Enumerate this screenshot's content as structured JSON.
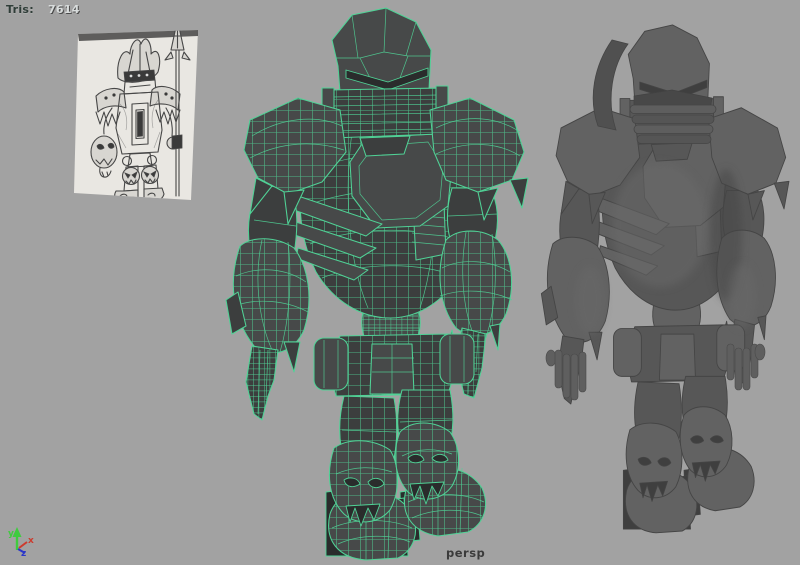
{
  "hud": {
    "tris_label": "Tris:",
    "tris_value": "7614"
  },
  "viewport": {
    "camera_label": "persp"
  },
  "axis_gizmo": {
    "x": "x",
    "y": "y",
    "z": "z"
  },
  "objects": {
    "reference_sketch": "robot-warrior-concept-sketch",
    "wireframe_model": "robot-low-poly-wireframe",
    "shaded_model": "robot-smooth-shaded"
  },
  "colors": {
    "background": "#a2a2a2",
    "wireframe_green": "#50d296",
    "model_dark": "#3c3e3e",
    "model_dark_alt": "#474949",
    "model_darkest": "#2a2c2c",
    "shaded_base": "#575757",
    "shaded_light": "#626262",
    "shaded_dark": "#3f3f3f",
    "axis_x": "#cc3b2e",
    "axis_y": "#3fcb3f",
    "axis_z": "#2b37c9",
    "hud_label": "#2f3d38",
    "hud_value": "#d9dddd",
    "camera_label": "#3b3b3b",
    "paper": "#e9e7e2",
    "pencil": "#474747"
  }
}
